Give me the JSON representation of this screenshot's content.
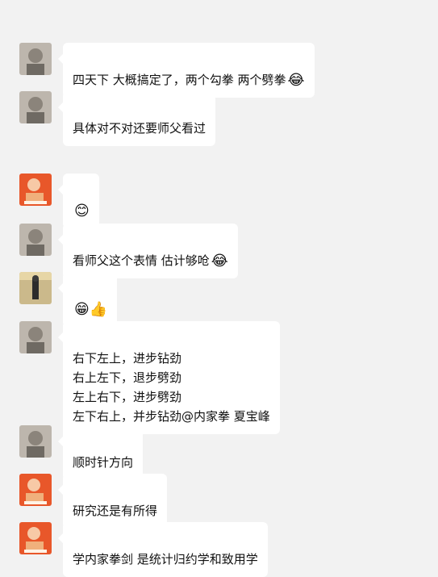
{
  "messages": [
    {
      "text": "四天下 大概搞定了，两个勾拳 两个劈拳",
      "emoji": "😂"
    },
    {
      "text": "具体对不对还要师父看过"
    },
    {
      "text": "",
      "emoji": "😊"
    },
    {
      "text": "看师父这个表情 估计够呛",
      "emoji": "😂"
    },
    {
      "text": "",
      "emoji": "😁👍"
    },
    {
      "text": "右下左上，进步钻劲\n右上左下，退步劈劲\n左上右下，进步劈劲\n左下右上，并步钻劲@内家拳 夏宝峰"
    },
    {
      "text": "顺时针方向"
    },
    {
      "text": "研究还是有所得"
    },
    {
      "text": "学内家拳剑 是统计归约学和致用学"
    }
  ],
  "avatars": {
    "gray": {
      "bg": "#b9b3aa",
      "fg": "#6f6a63"
    },
    "orange": {
      "bg": "#e8572a",
      "fg": "#f7c9a6"
    },
    "dark": {
      "bg": "#cbb98b",
      "fg": "#2b2b2b"
    }
  }
}
